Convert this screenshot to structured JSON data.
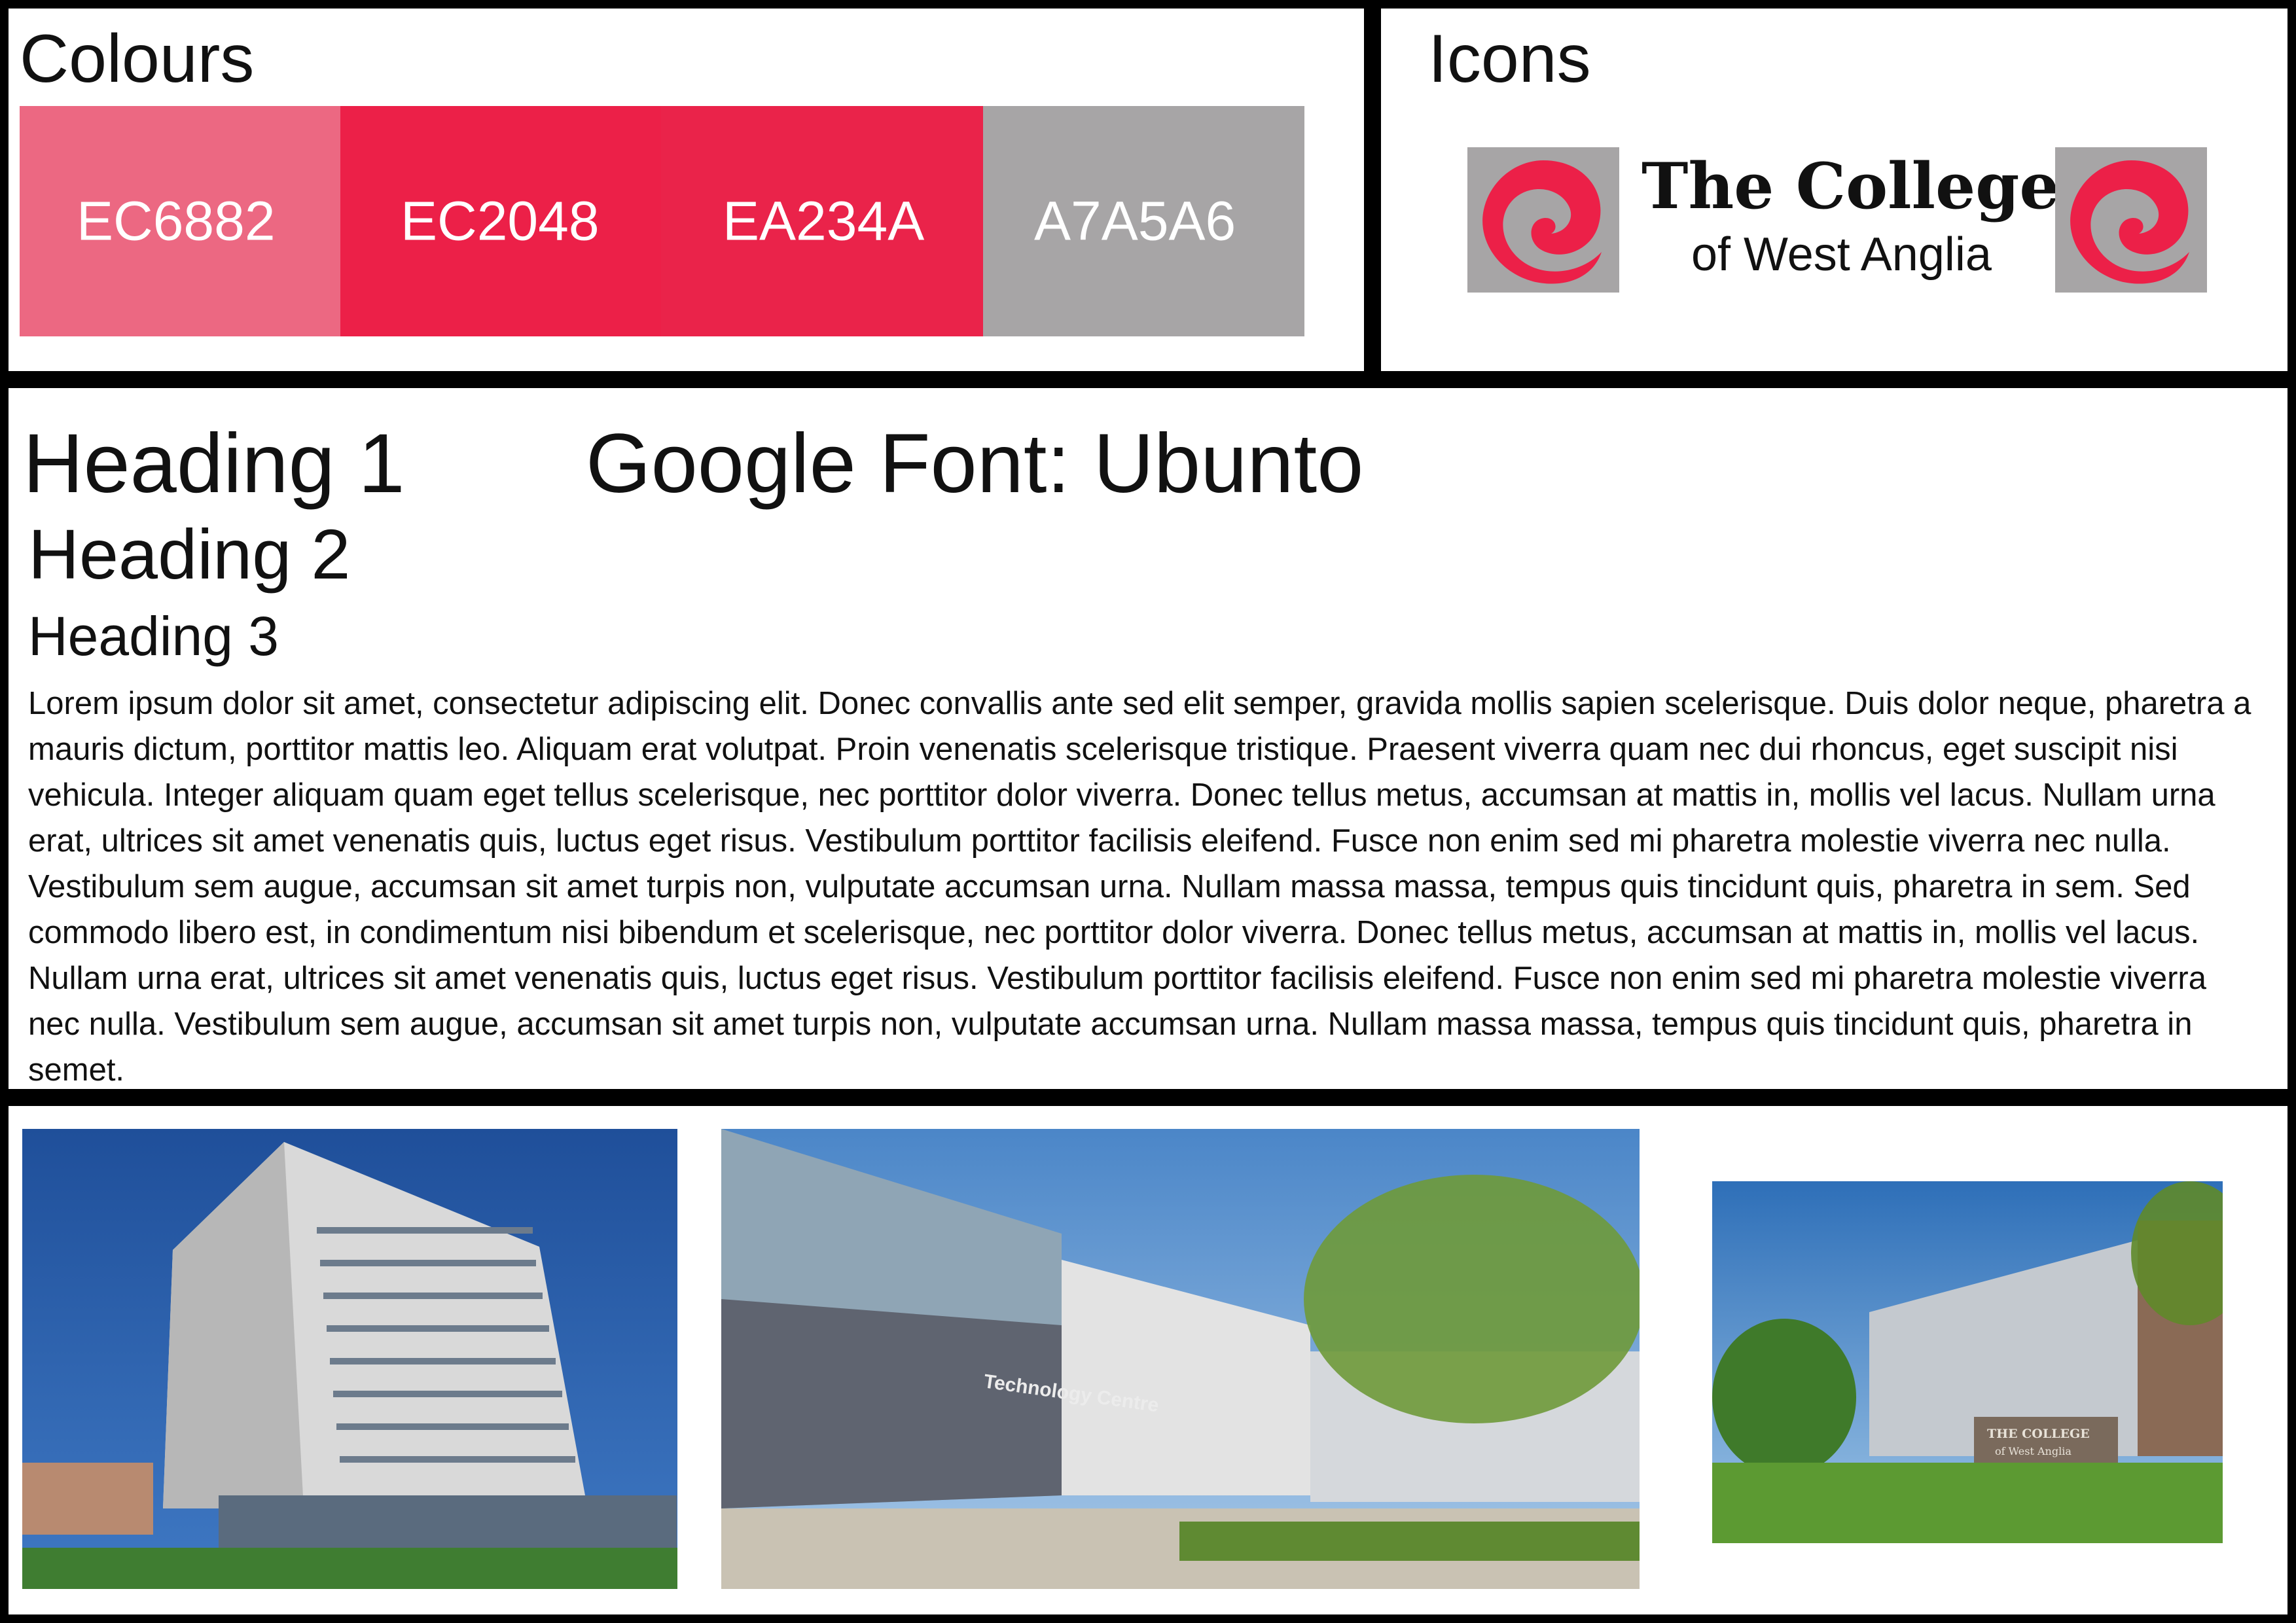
{
  "colours": {
    "title": "Colours",
    "swatches": [
      {
        "label": "EC6882",
        "hex": "#EC6882"
      },
      {
        "label": "EC2048",
        "hex": "#EC2048"
      },
      {
        "label": "EA234A",
        "hex": "#EA234A"
      },
      {
        "label": "A7A5A6",
        "hex": "#A7A5A6"
      }
    ]
  },
  "icons": {
    "title": "Icons",
    "logo": {
      "line1": "The College",
      "line2": "of West Anglia"
    }
  },
  "typography": {
    "heading1": "Heading 1",
    "font_note": "Google Font: Ubunto",
    "heading2": "Heading 2",
    "heading3": "Heading 3",
    "body": "Lorem ipsum dolor sit amet, consectetur adipiscing elit. Donec convallis ante sed elit semper, gravida mollis sapien scelerisque. Duis dolor neque, pharetra a mauris dictum, porttitor mattis leo. Aliquam erat volutpat. Proin venenatis scelerisque tristique. Praesent viverra quam nec dui rhoncus, eget suscipit nisi vehicula. Integer aliquam quam eget tellus scelerisque, nec porttitor dolor viverra. Donec tellus metus, accumsan at mattis in, mollis vel lacus. Nullam urna erat, ultrices sit amet venenatis quis, luctus eget risus. Vestibulum porttitor facilisis eleifend. Fusce non enim sed mi pharetra molestie viverra nec nulla. Vestibulum sem augue, accumsan sit amet turpis non, vulputate accumsan urna. Nullam massa massa, tempus quis tincidunt quis, pharetra in sem. Sed commodo libero est, in condimentum nisi bibendum et scelerisque, nec porttitor dolor viverra. Donec tellus metus, accumsan at mattis in, mollis vel lacus. Nullam urna erat, ultrices sit amet venenatis quis, luctus eget risus. Vestibulum porttitor facilisis eleifend. Fusce non enim sed mi pharetra molestie viverra nec nulla. Vestibulum sem augue, accumsan sit amet turpis non, vulputate accumsan urna. Nullam massa massa, tempus quis tincidunt quis, pharetra in semet."
  },
  "photos": {
    "photo2_sign": "Technology Centre",
    "photo3_sign": {
      "line1": "THE COLLEGE",
      "line2": "of West Anglia"
    }
  }
}
